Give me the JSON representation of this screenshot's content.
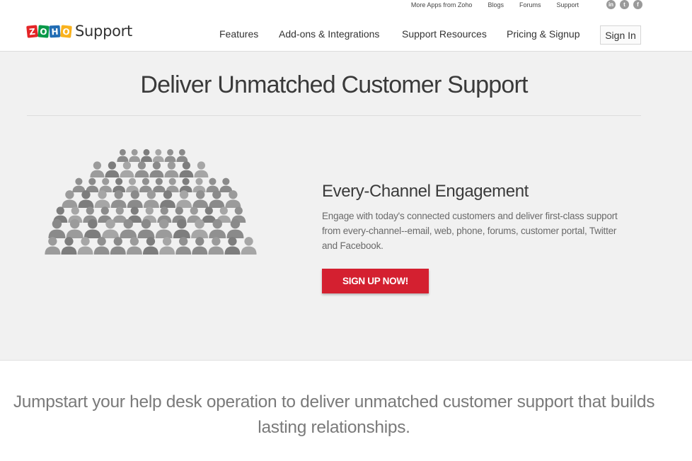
{
  "utility": {
    "links": [
      "More Apps from Zoho",
      "Blogs",
      "Forums",
      "Support"
    ],
    "social": [
      {
        "icon": "linkedin-icon",
        "glyph": "in"
      },
      {
        "icon": "twitter-icon",
        "glyph": "t"
      },
      {
        "icon": "facebook-icon",
        "glyph": "f"
      }
    ]
  },
  "header": {
    "logo_letters": [
      {
        "char": "Z",
        "color": "#e42527"
      },
      {
        "char": "O",
        "color": "#089949"
      },
      {
        "char": "H",
        "color": "#226db4"
      },
      {
        "char": "O",
        "color": "#f9b21d"
      }
    ],
    "logo_text": "Support",
    "nav": [
      "Features",
      "Add-ons & Integrations",
      "Support Resources",
      "Pricing & Signup"
    ],
    "signin_label": "Sign In"
  },
  "hero": {
    "title": "Deliver Unmatched Customer Support",
    "feature_title": "Every-Channel Engagement",
    "feature_desc": "Engage with today's connected customers and deliver first-class support from every-channel--email, web, phone, forums, customer portal, Twitter and Facebook.",
    "cta_label": "SIGN UP NOW!",
    "colors": {
      "cta": "#d42030",
      "background": "#f1f1f1"
    }
  },
  "tagline": "Jumpstart your help desk operation to deliver unmatched customer support that builds lasting relationships."
}
